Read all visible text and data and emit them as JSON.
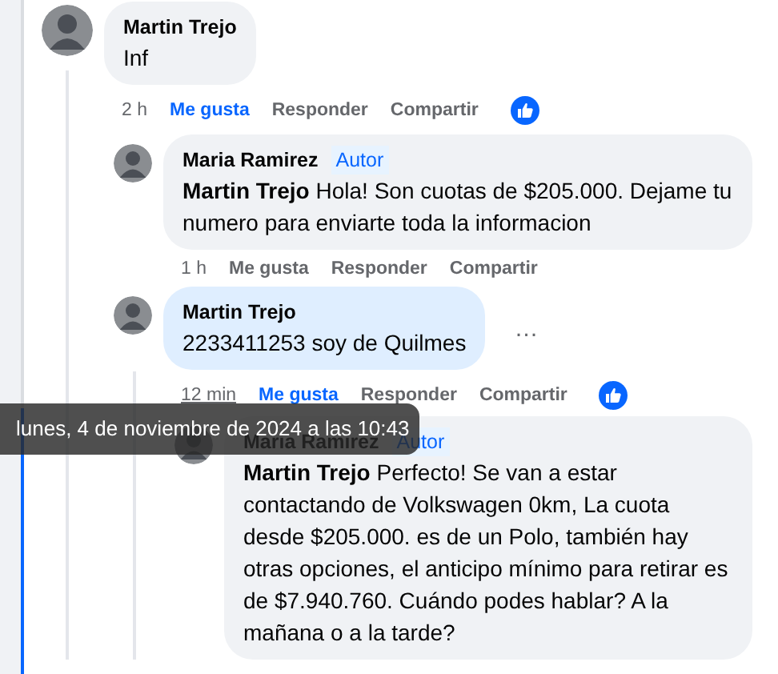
{
  "comments": [
    {
      "name": "Martin Trejo",
      "text": "Inf",
      "time": "2 h",
      "time_hovered": false,
      "highlighted": false,
      "liked": true,
      "like_label": "Me gusta",
      "reply_label": "Responder",
      "share_label": "Compartir",
      "reacted": true,
      "children": [
        {
          "name": "Maria Ramirez",
          "badge": "Autor",
          "text": "**Martin Trejo** Hola! Son cuotas de $205.000. Dejame tu numero para enviarte toda la informacion",
          "time": "1 h",
          "time_hovered": false,
          "highlighted": false,
          "liked": false,
          "like_label": "Me gusta",
          "reply_label": "Responder",
          "share_label": "Compartir"
        },
        {
          "name": "Martin Trejo",
          "text": "2233411253 soy de Quilmes",
          "more": "…",
          "time": "12 min",
          "time_hovered": true,
          "highlighted": true,
          "liked": true,
          "like_label": "Me gusta",
          "reply_label": "Responder",
          "share_label": "Compartir",
          "reacted": true,
          "children": [
            {
              "name": "Maria Ramirez",
              "badge": "Autor",
              "text": "**Martin Trejo** Perfecto! Se van a estar contactando de Volkswagen 0km, La cuota desde $205.000. es de un Polo, también hay otras opciones, el anticipo mínimo para retirar es de $7.940.760. Cuándo podes hablar? A la mañana o a la tarde?"
            }
          ]
        }
      ]
    }
  ],
  "tooltip": {
    "text": "lunes, 4 de noviembre de 2024 a las 10:43"
  }
}
